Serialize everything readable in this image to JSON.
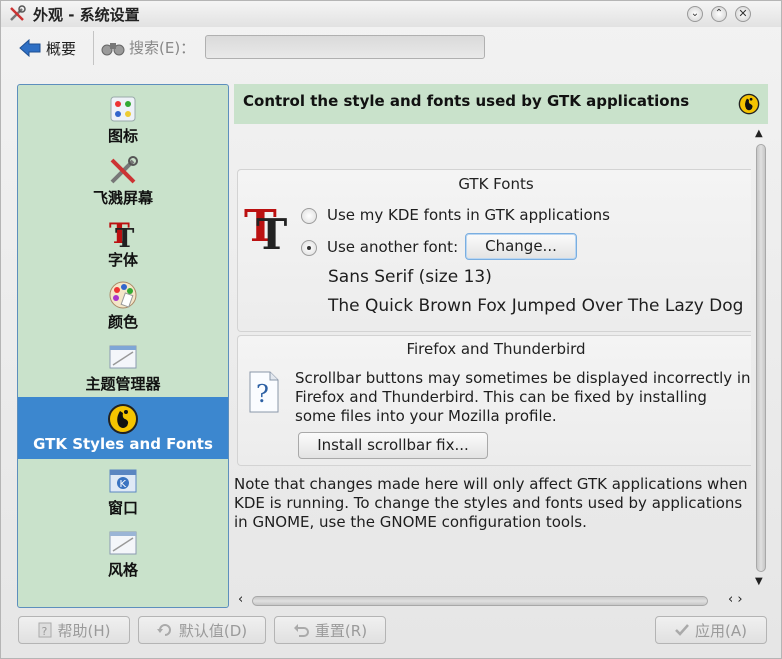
{
  "window": {
    "title": "外观 - 系统设置"
  },
  "toolbar": {
    "overview_label": "概要",
    "search_label": "搜索(E)：",
    "search_value": ""
  },
  "sidebar": {
    "items": [
      {
        "label": "图标",
        "icon": "icons-icon"
      },
      {
        "label": "飞溅屏幕",
        "icon": "splash-screen-icon"
      },
      {
        "label": "字体",
        "icon": "font-icon"
      },
      {
        "label": "颜色",
        "icon": "colors-icon"
      },
      {
        "label": "主题管理器",
        "icon": "theme-manager-icon"
      },
      {
        "label": "GTK Styles and Fonts",
        "icon": "gtk-icon",
        "selected": true
      },
      {
        "label": "窗口",
        "icon": "window-icon"
      },
      {
        "label": "风格",
        "icon": "style-icon"
      }
    ]
  },
  "header": {
    "title": "Control the style and fonts used by GTK applications"
  },
  "gtk_fonts": {
    "title": "GTK Fonts",
    "option_kde": "Use my KDE fonts in GTK applications",
    "option_other": "Use another font:",
    "selected_option": "other",
    "change_label": "Change...",
    "font_name": "Sans Serif (size 13)",
    "preview": "The Quick Brown Fox Jumped Over The Lazy Dog"
  },
  "firefox": {
    "title": "Firefox and Thunderbird",
    "text_line1": "Scrollbar buttons may sometimes be displayed incorrectly in",
    "text_line2": "Firefox and Thunderbird.  This can be fixed by installing",
    "text_line3": "some files into your Mozilla profile.",
    "install_label": "Install scrollbar fix..."
  },
  "note": {
    "line1": "Note that changes made here will only affect GTK applications when",
    "line2": "KDE is running.  To change the styles and fonts used by applications",
    "line3": "in GNOME, use the GNOME configuration tools."
  },
  "buttons": {
    "help": "帮助(H)",
    "defaults": "默认值(D)",
    "reset": "重置(R)",
    "apply": "应用(A)"
  }
}
